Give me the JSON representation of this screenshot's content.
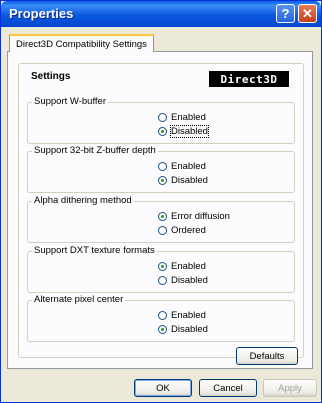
{
  "window": {
    "title": "Properties"
  },
  "tabs": [
    {
      "label": "Direct3D Compatibility Settings"
    }
  ],
  "settings": {
    "title": "Settings",
    "logo_text": "Direct3D",
    "groups": [
      {
        "label": "Support W-buffer",
        "options": [
          {
            "label": "Enabled",
            "selected": false
          },
          {
            "label": "Disabled",
            "selected": true
          }
        ]
      },
      {
        "label": "Support 32-bit Z-buffer depth",
        "options": [
          {
            "label": "Enabled",
            "selected": false
          },
          {
            "label": "Disabled",
            "selected": true
          }
        ]
      },
      {
        "label": "Alpha dithering method",
        "options": [
          {
            "label": "Error diffusion",
            "selected": true
          },
          {
            "label": "Ordered",
            "selected": false
          }
        ]
      },
      {
        "label": "Support DXT texture formats",
        "options": [
          {
            "label": "Enabled",
            "selected": true
          },
          {
            "label": "Disabled",
            "selected": false
          }
        ]
      },
      {
        "label": "Alternate pixel center",
        "options": [
          {
            "label": "Enabled",
            "selected": false
          },
          {
            "label": "Disabled",
            "selected": true
          }
        ]
      }
    ],
    "defaults_button": "Defaults"
  },
  "footer": {
    "ok": "OK",
    "cancel": "Cancel",
    "apply": "Apply"
  },
  "icons": {
    "help": "help-icon",
    "close": "close-icon"
  },
  "colors": {
    "titlebar": "#0a58e0",
    "dialog_bg": "#ece9d8",
    "panel_bg": "#fcfcfe",
    "radio_dot": "#21a121"
  }
}
